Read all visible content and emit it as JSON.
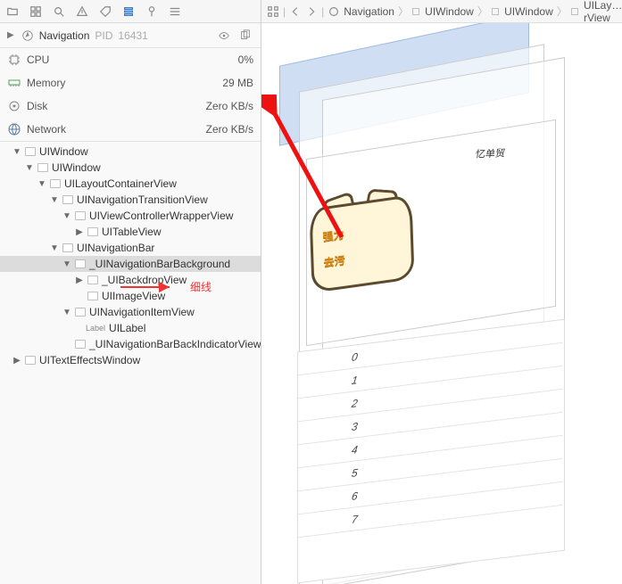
{
  "toolbar_icons": [
    "folder-icon",
    "grid-icon",
    "search-icon",
    "warning-icon",
    "tag-icon",
    "stack-icon",
    "pin-icon",
    "menu-icon"
  ],
  "nav_header": {
    "title": "Navigation",
    "pid_prefix": "PID",
    "pid": "16431"
  },
  "metrics": [
    {
      "icon": "cpu-icon",
      "label": "CPU",
      "value": "0%"
    },
    {
      "icon": "memory-icon",
      "label": "Memory",
      "value": "29 MB"
    },
    {
      "icon": "disk-icon",
      "label": "Disk",
      "value": "Zero KB/s"
    },
    {
      "icon": "network-icon",
      "label": "Network",
      "value": "Zero KB/s"
    }
  ],
  "tree": [
    {
      "depth": 0,
      "arrow": "down",
      "label": "UIWindow"
    },
    {
      "depth": 1,
      "arrow": "down",
      "label": "UIWindow"
    },
    {
      "depth": 2,
      "arrow": "down",
      "label": "UILayoutContainerView"
    },
    {
      "depth": 3,
      "arrow": "down",
      "label": "UINavigationTransitionView"
    },
    {
      "depth": 4,
      "arrow": "down",
      "label": "UIViewControllerWrapperView"
    },
    {
      "depth": 5,
      "arrow": "right",
      "label": "UITableView"
    },
    {
      "depth": 3,
      "arrow": "down",
      "label": "UINavigationBar"
    },
    {
      "depth": 4,
      "arrow": "down",
      "label": "_UINavigationBarBackground",
      "selected": true
    },
    {
      "depth": 5,
      "arrow": "right",
      "label": "_UIBackdropView"
    },
    {
      "depth": 5,
      "arrow": "none",
      "label": "UIImageView"
    },
    {
      "depth": 4,
      "arrow": "down",
      "label": "UINavigationItemView"
    },
    {
      "depth": 5,
      "arrow": "none",
      "label": "UILabel",
      "labeltag": "Label"
    },
    {
      "depth": 4,
      "arrow": "none",
      "label": "_UINavigationBarBackIndicatorView"
    },
    {
      "depth": 0,
      "arrow": "right",
      "label": "UITextEffectsWindow"
    }
  ],
  "annotation": {
    "text": "细线"
  },
  "breadcrumb": {
    "items": [
      "Navigation",
      "UIWindow",
      "UIWindow",
      "UILay…rView"
    ]
  },
  "preview": {
    "tiny_label": "忆单贸",
    "sticker_text_line1": "强力",
    "sticker_text_line2": "去污",
    "rows": [
      "0",
      "1",
      "2",
      "3",
      "4",
      "5",
      "6",
      "7"
    ]
  }
}
